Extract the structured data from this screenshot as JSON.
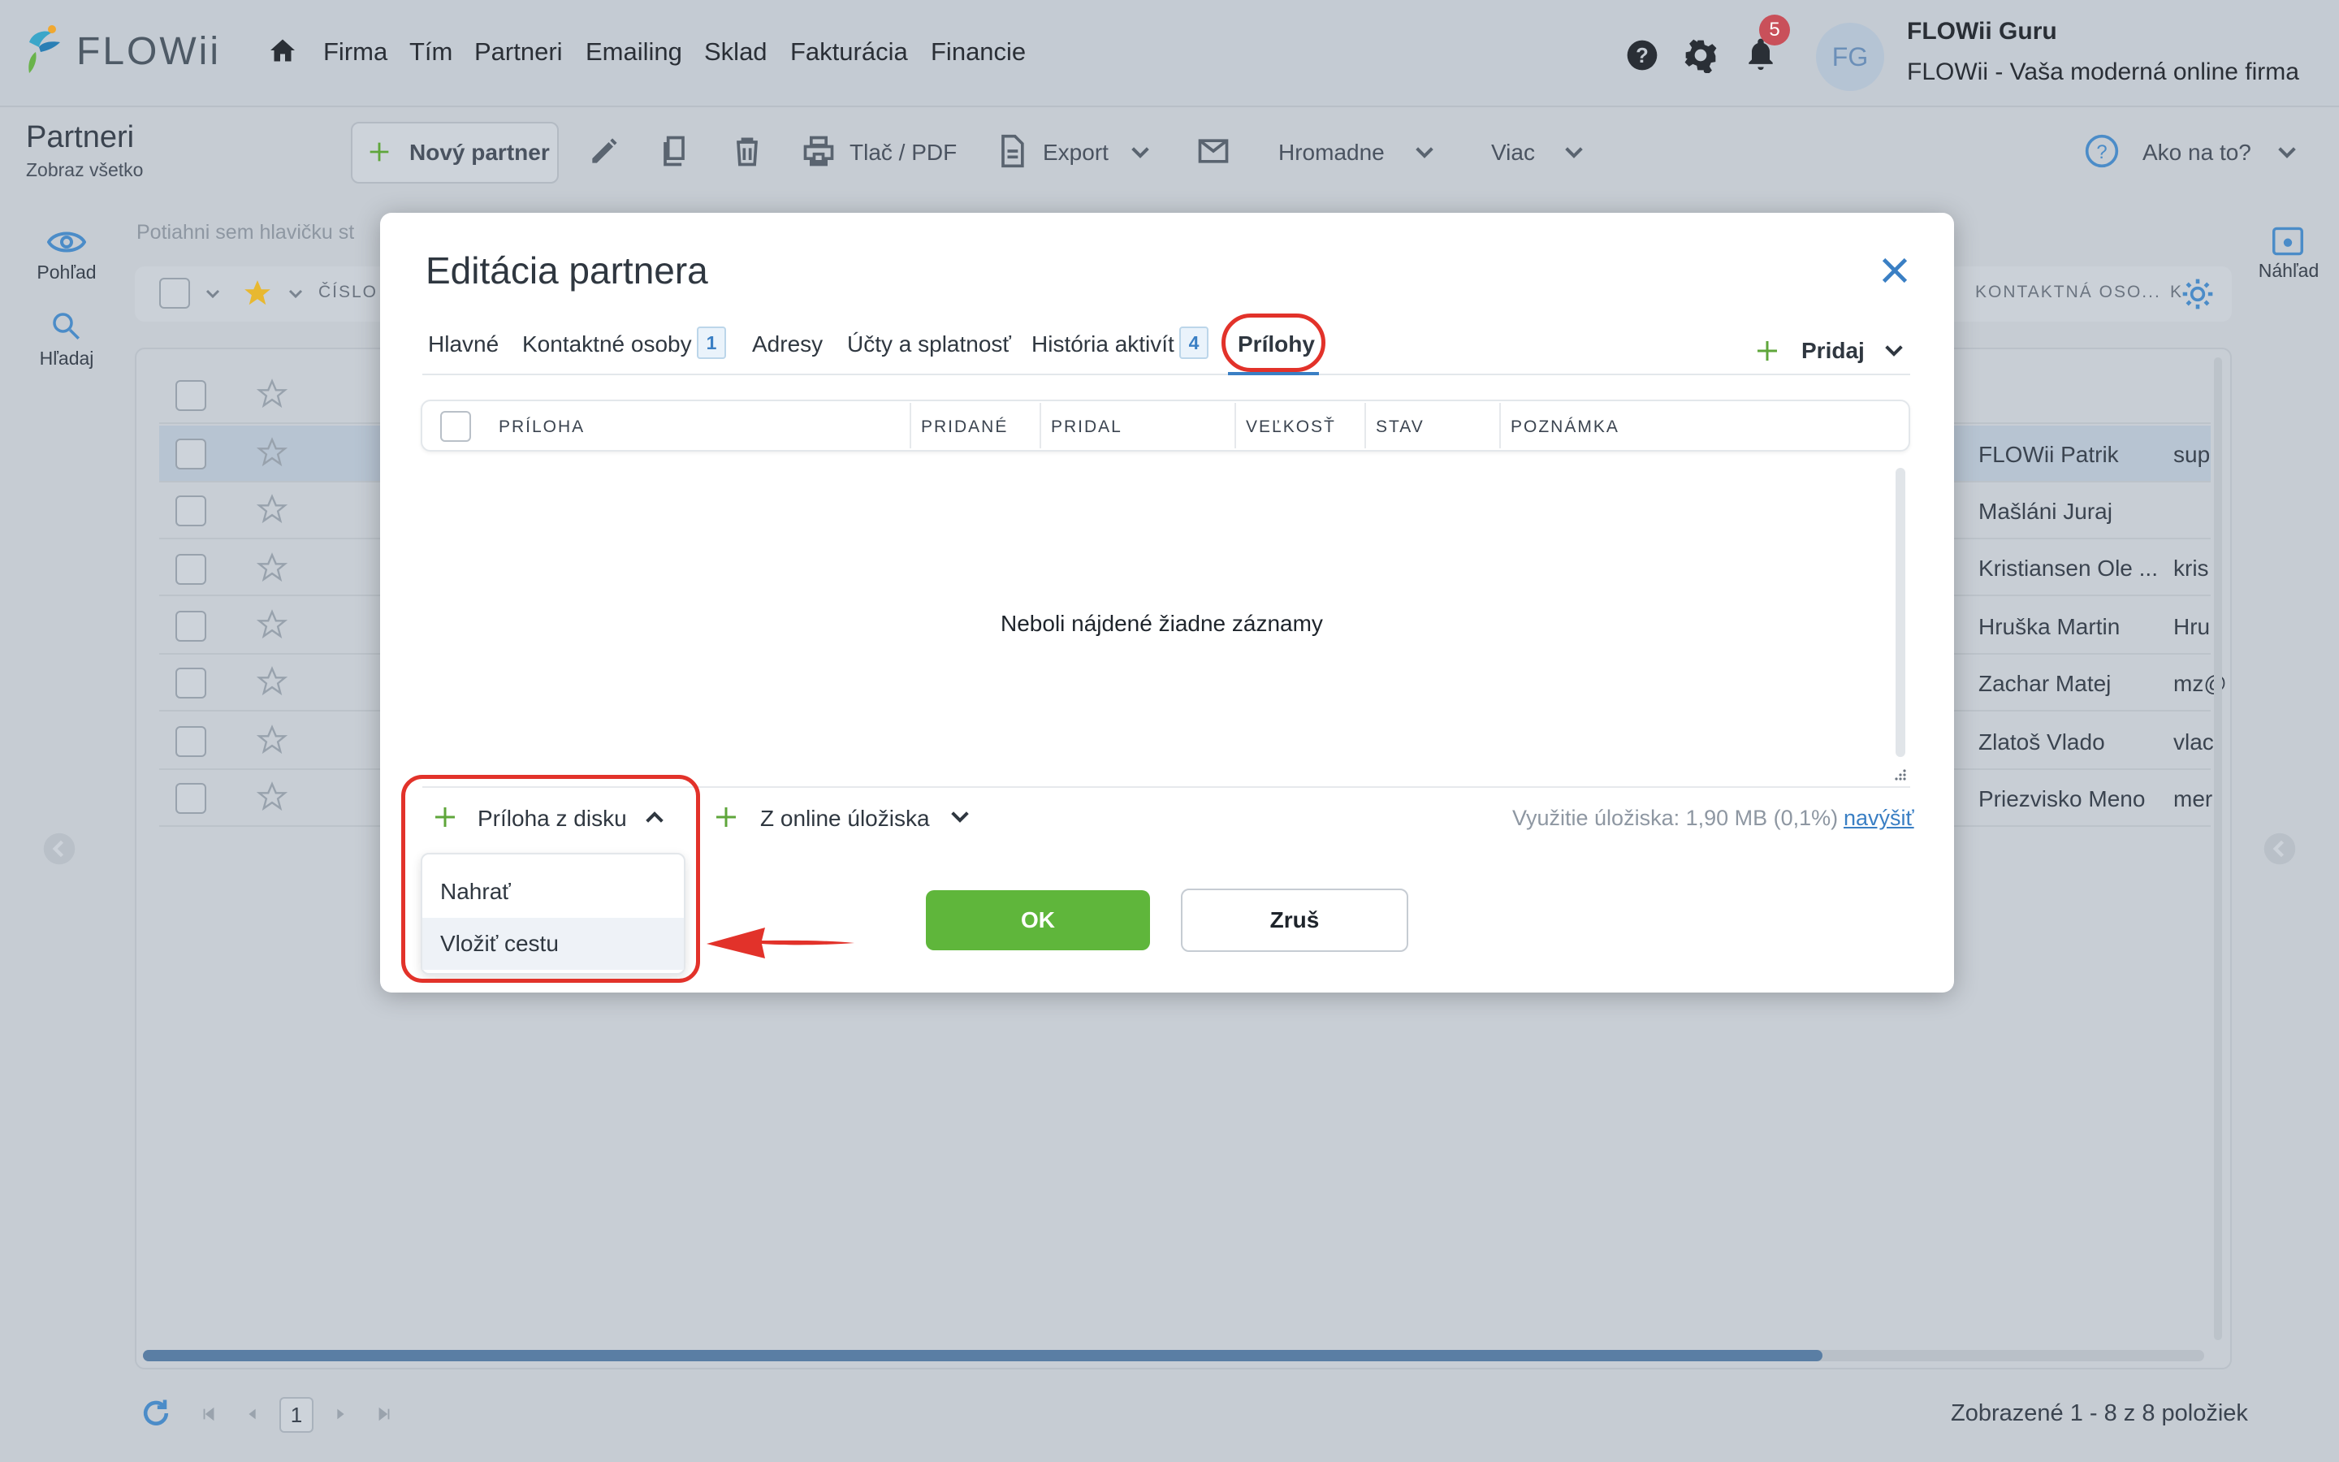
{
  "app": {
    "brand": "FLOWii",
    "nav": [
      "Firma",
      "Tím",
      "Partneri",
      "Emailing",
      "Sklad",
      "Fakturácia",
      "Financie"
    ],
    "notifications_count": "5",
    "avatar_initials": "FG",
    "user_name": "FLOWii Guru",
    "user_company": "FLOWii - Vaša moderná online firma"
  },
  "page": {
    "title": "Partneri",
    "subtitle": "Zobraz všetko",
    "toolbar": {
      "new_partner": "Nový partner",
      "print": "Tlač / PDF",
      "export": "Export",
      "bulk": "Hromadne",
      "more": "Viac",
      "howto": "Ako na to?"
    },
    "side": {
      "view": "Pohľad",
      "search": "Hľadaj",
      "preview": "Náhľad"
    },
    "drag_hint": "Potiahni sem hlavičku st",
    "filter": {
      "col_number": "ČÍSLO",
      "col_contact": "KONTAKTNÁ OSO...",
      "col_k": "K"
    },
    "rows": [
      {
        "contact": "FLOWii Patrik",
        "extra": "sup"
      },
      {
        "contact": "Mašláni Juraj",
        "extra": ""
      },
      {
        "contact": "Kristiansen Ole ...",
        "extra": "kris"
      },
      {
        "contact": "Hruška Martin",
        "extra": "Hru"
      },
      {
        "contact": "Zachar Matej",
        "extra": "mz@"
      },
      {
        "contact": "Zlatoš Vlado",
        "extra": "vlac"
      },
      {
        "contact": "Priezvisko Meno",
        "extra": "mer"
      }
    ],
    "pager_page": "1",
    "pager_info": "Zobrazené 1 - 8 z 8 položiek"
  },
  "modal": {
    "title": "Editácia partnera",
    "tabs": [
      {
        "label": "Hlavné"
      },
      {
        "label": "Kontaktné osoby",
        "badge": "1"
      },
      {
        "label": "Adresy"
      },
      {
        "label": "Účty a splatnosť"
      },
      {
        "label": "História aktivít",
        "badge": "4"
      },
      {
        "label": "Prílohy"
      }
    ],
    "add_label": "Pridaj",
    "columns": [
      "PRÍLOHA",
      "PRIDANÉ",
      "PRIDAL",
      "VEĽKOSŤ",
      "STAV",
      "POZNÁMKA"
    ],
    "empty_message": "Neboli nájdené žiadne záznamy",
    "attach_disk": "Príloha z disku",
    "attach_online": "Z online úložiska",
    "storage_label": "Využitie úložiska:  1,90 MB (0,1%)",
    "storage_link": "navýšiť",
    "dropdown": [
      "Nahrať",
      "Vložiť cestu"
    ],
    "ok": "OK",
    "cancel": "Zruš"
  },
  "colors": {
    "accent": "#3a7fc4",
    "ok_green": "#5fb63b",
    "annotation_red": "#e2322a",
    "badge_red": "#c9505a",
    "star": "#e8b830"
  }
}
